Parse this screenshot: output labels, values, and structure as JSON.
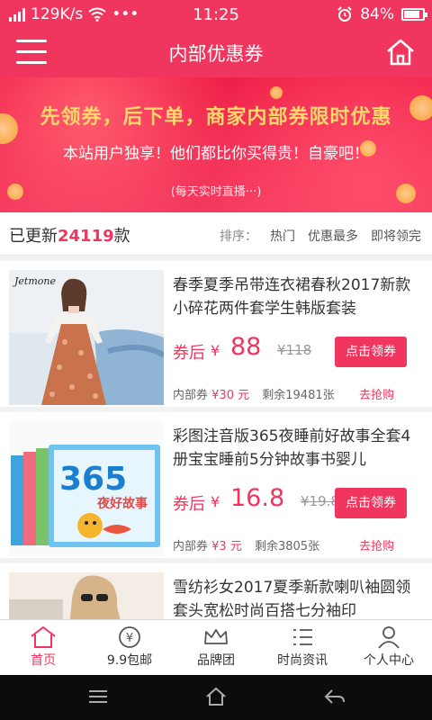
{
  "status": {
    "speed": "129K/s",
    "dots": "•••",
    "time": "11:25",
    "battery": "84%"
  },
  "nav": {
    "title": "内部优惠券"
  },
  "banner": {
    "headline": "先领券，后下单，商家内部券限时优惠",
    "sub": "本站用户独享！他们都比你买得贵！自豪吧！",
    "live": "(每天实时直播···)"
  },
  "sortbar": {
    "prefix": "已更新",
    "count": "24119",
    "suffix": "款",
    "sort_label": "排序：",
    "options": [
      "热门",
      "优惠最多",
      "即将领完"
    ]
  },
  "items": [
    {
      "name": "春季夏季吊带连衣裙春秋2017新款小碎花两件套学生韩版套装",
      "after_label": "券后",
      "yen": "¥",
      "price": "88",
      "orig": "¥118",
      "button": "点击领券",
      "coupon_label": "内部券",
      "coupon": "¥30 元",
      "remaining": "剩余19481张",
      "grab": "去抢购",
      "brand": "Jetmone"
    },
    {
      "name": "彩图注音版365夜睡前好故事全套4册宝宝睡前5分钟故事书婴儿",
      "after_label": "券后",
      "yen": "¥",
      "price": "16.8",
      "orig": "¥19.8",
      "button": "点击领券",
      "coupon_label": "内部券",
      "coupon": "¥3 元",
      "remaining": "剩余3805张",
      "grab": "去抢购",
      "book_title": "365",
      "book_sub": "夜好故事"
    },
    {
      "name": "雪纺衫女2017夏季新款喇叭袖圆领套头宽松时尚百搭七分袖印"
    }
  ],
  "tabs": [
    {
      "label": "首页",
      "icon": "home-icon"
    },
    {
      "label": "9.9包邮",
      "icon": "yen-coin-icon"
    },
    {
      "label": "品牌团",
      "icon": "crown-icon"
    },
    {
      "label": "时尚资讯",
      "icon": "list-icon"
    },
    {
      "label": "个人中心",
      "icon": "user-icon"
    }
  ],
  "colors": {
    "accent": "#f0355e",
    "gold": "#ffd86b"
  }
}
